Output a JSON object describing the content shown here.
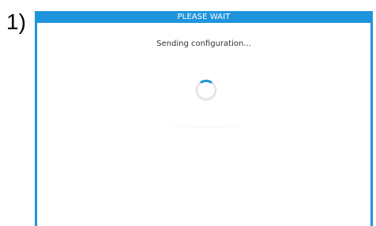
{
  "step_marker": "1)",
  "dialog": {
    "title": "PLEASE WAIT",
    "message": "Sending configuration...",
    "spinner_icon": "loading-spinner-icon",
    "accent_color": "#1f94dc"
  }
}
